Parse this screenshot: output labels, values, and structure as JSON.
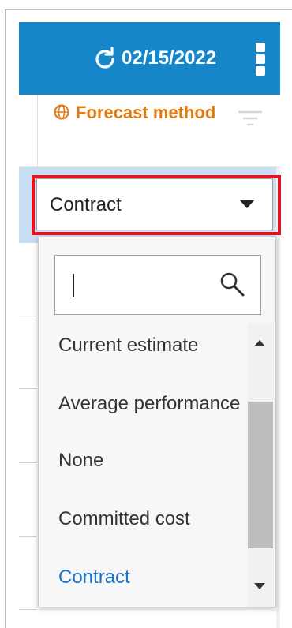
{
  "toolbar": {
    "date": "02/15/2022",
    "refresh_icon": "refresh-icon",
    "menu_icon": "kebab-menu-icon",
    "background_color": "#1686c8"
  },
  "column_header": {
    "label": "Forecast method",
    "icon": "globe-icon",
    "filter_icon": "filter-icon",
    "label_color": "#e07b12"
  },
  "select": {
    "value": "Contract",
    "caret_icon": "caret-down-icon"
  },
  "dropdown": {
    "search": {
      "value": "",
      "icon": "search-icon"
    },
    "options": [
      {
        "label": "Current estimate",
        "selected": false
      },
      {
        "label": "Average performance",
        "selected": false
      },
      {
        "label": "None",
        "selected": false
      },
      {
        "label": "Committed cost",
        "selected": false
      },
      {
        "label": "Contract",
        "selected": true
      }
    ],
    "selected_color": "#1a73c9"
  },
  "highlight_color": "#e3141c"
}
